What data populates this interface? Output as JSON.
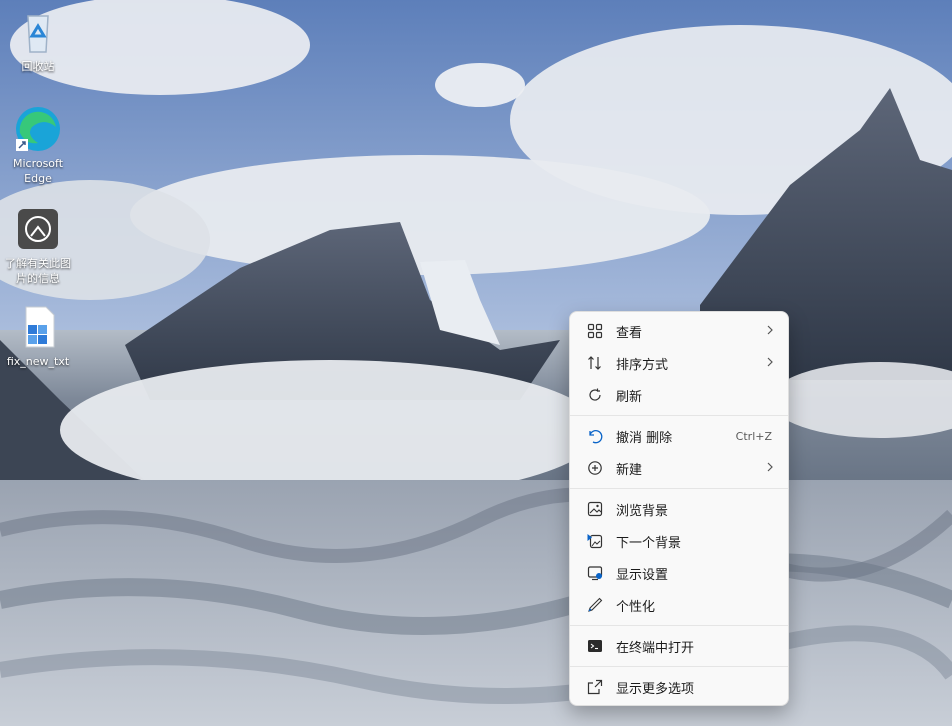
{
  "desktop_icons": [
    {
      "label": "回收站",
      "icon": "recycle-bin-icon"
    },
    {
      "label": "Microsoft Edge",
      "icon": "edge-icon"
    },
    {
      "label": "了解有关此图片的信息",
      "icon": "info-person-icon"
    },
    {
      "label": "fix_new_txt",
      "icon": "file-icon"
    }
  ],
  "menu": {
    "view": {
      "label": "查看",
      "icon": "grid-icon"
    },
    "sort": {
      "label": "排序方式",
      "icon": "sort-icon"
    },
    "refresh": {
      "label": "刷新",
      "icon": "refresh-icon"
    },
    "undo": {
      "label": "撤消 删除",
      "shortcut": "Ctrl+Z",
      "icon": "undo-icon"
    },
    "new": {
      "label": "新建",
      "icon": "plus-circle-icon"
    },
    "browse_bg": {
      "label": "浏览背景",
      "icon": "image-icon"
    },
    "next_bg": {
      "label": "下一个背景",
      "icon": "next-image-icon"
    },
    "display": {
      "label": "显示设置",
      "icon": "display-icon"
    },
    "personalize": {
      "label": "个性化",
      "icon": "pen-icon"
    },
    "terminal": {
      "label": "在终端中打开",
      "icon": "terminal-icon"
    },
    "more": {
      "label": "显示更多选项",
      "icon": "expand-icon"
    }
  },
  "colors": {
    "menu_bg": "#f9f9f9",
    "accent": "#0a64c8"
  }
}
